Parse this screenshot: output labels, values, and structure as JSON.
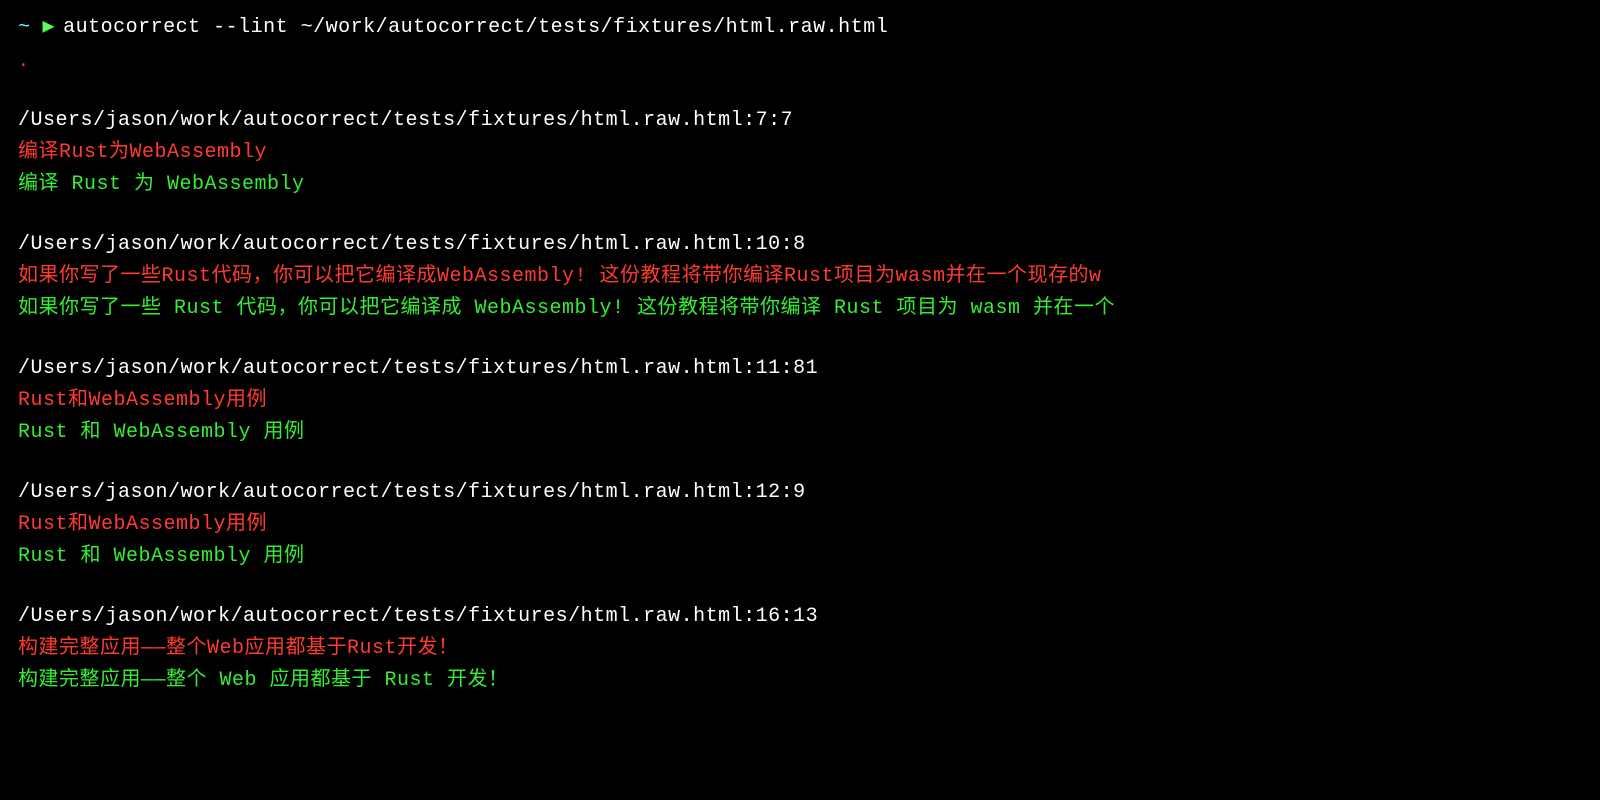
{
  "prompt": {
    "tilde": "~",
    "arrow": "▶",
    "command": "autocorrect --lint ~/work/autocorrect/tests/fixtures/html.raw.html"
  },
  "dot": ".",
  "results": [
    {
      "location": "/Users/jason/work/autocorrect/tests/fixtures/html.raw.html:7:7",
      "error": "编译Rust为WebAssembly",
      "fix": "编译 Rust 为 WebAssembly"
    },
    {
      "location": "/Users/jason/work/autocorrect/tests/fixtures/html.raw.html:10:8",
      "error": "如果你写了一些Rust代码，你可以把它编译成WebAssembly! 这份教程将带你编译Rust项目为wasm并在一个现存的w",
      "fix": "如果你写了一些 Rust 代码，你可以把它编译成 WebAssembly! 这份教程将带你编译 Rust 项目为 wasm 并在一个"
    },
    {
      "location": "/Users/jason/work/autocorrect/tests/fixtures/html.raw.html:11:81",
      "error": "Rust和WebAssembly用例",
      "fix": "Rust 和 WebAssembly 用例"
    },
    {
      "location": "/Users/jason/work/autocorrect/tests/fixtures/html.raw.html:12:9",
      "error": "Rust和WebAssembly用例",
      "fix": "Rust 和 WebAssembly 用例"
    },
    {
      "location": "/Users/jason/work/autocorrect/tests/fixtures/html.raw.html:16:13",
      "error": "构建完整应用——整个Web应用都基于Rust开发！",
      "fix": "构建完整应用——整个 Web 应用都基于 Rust 开发！"
    }
  ]
}
